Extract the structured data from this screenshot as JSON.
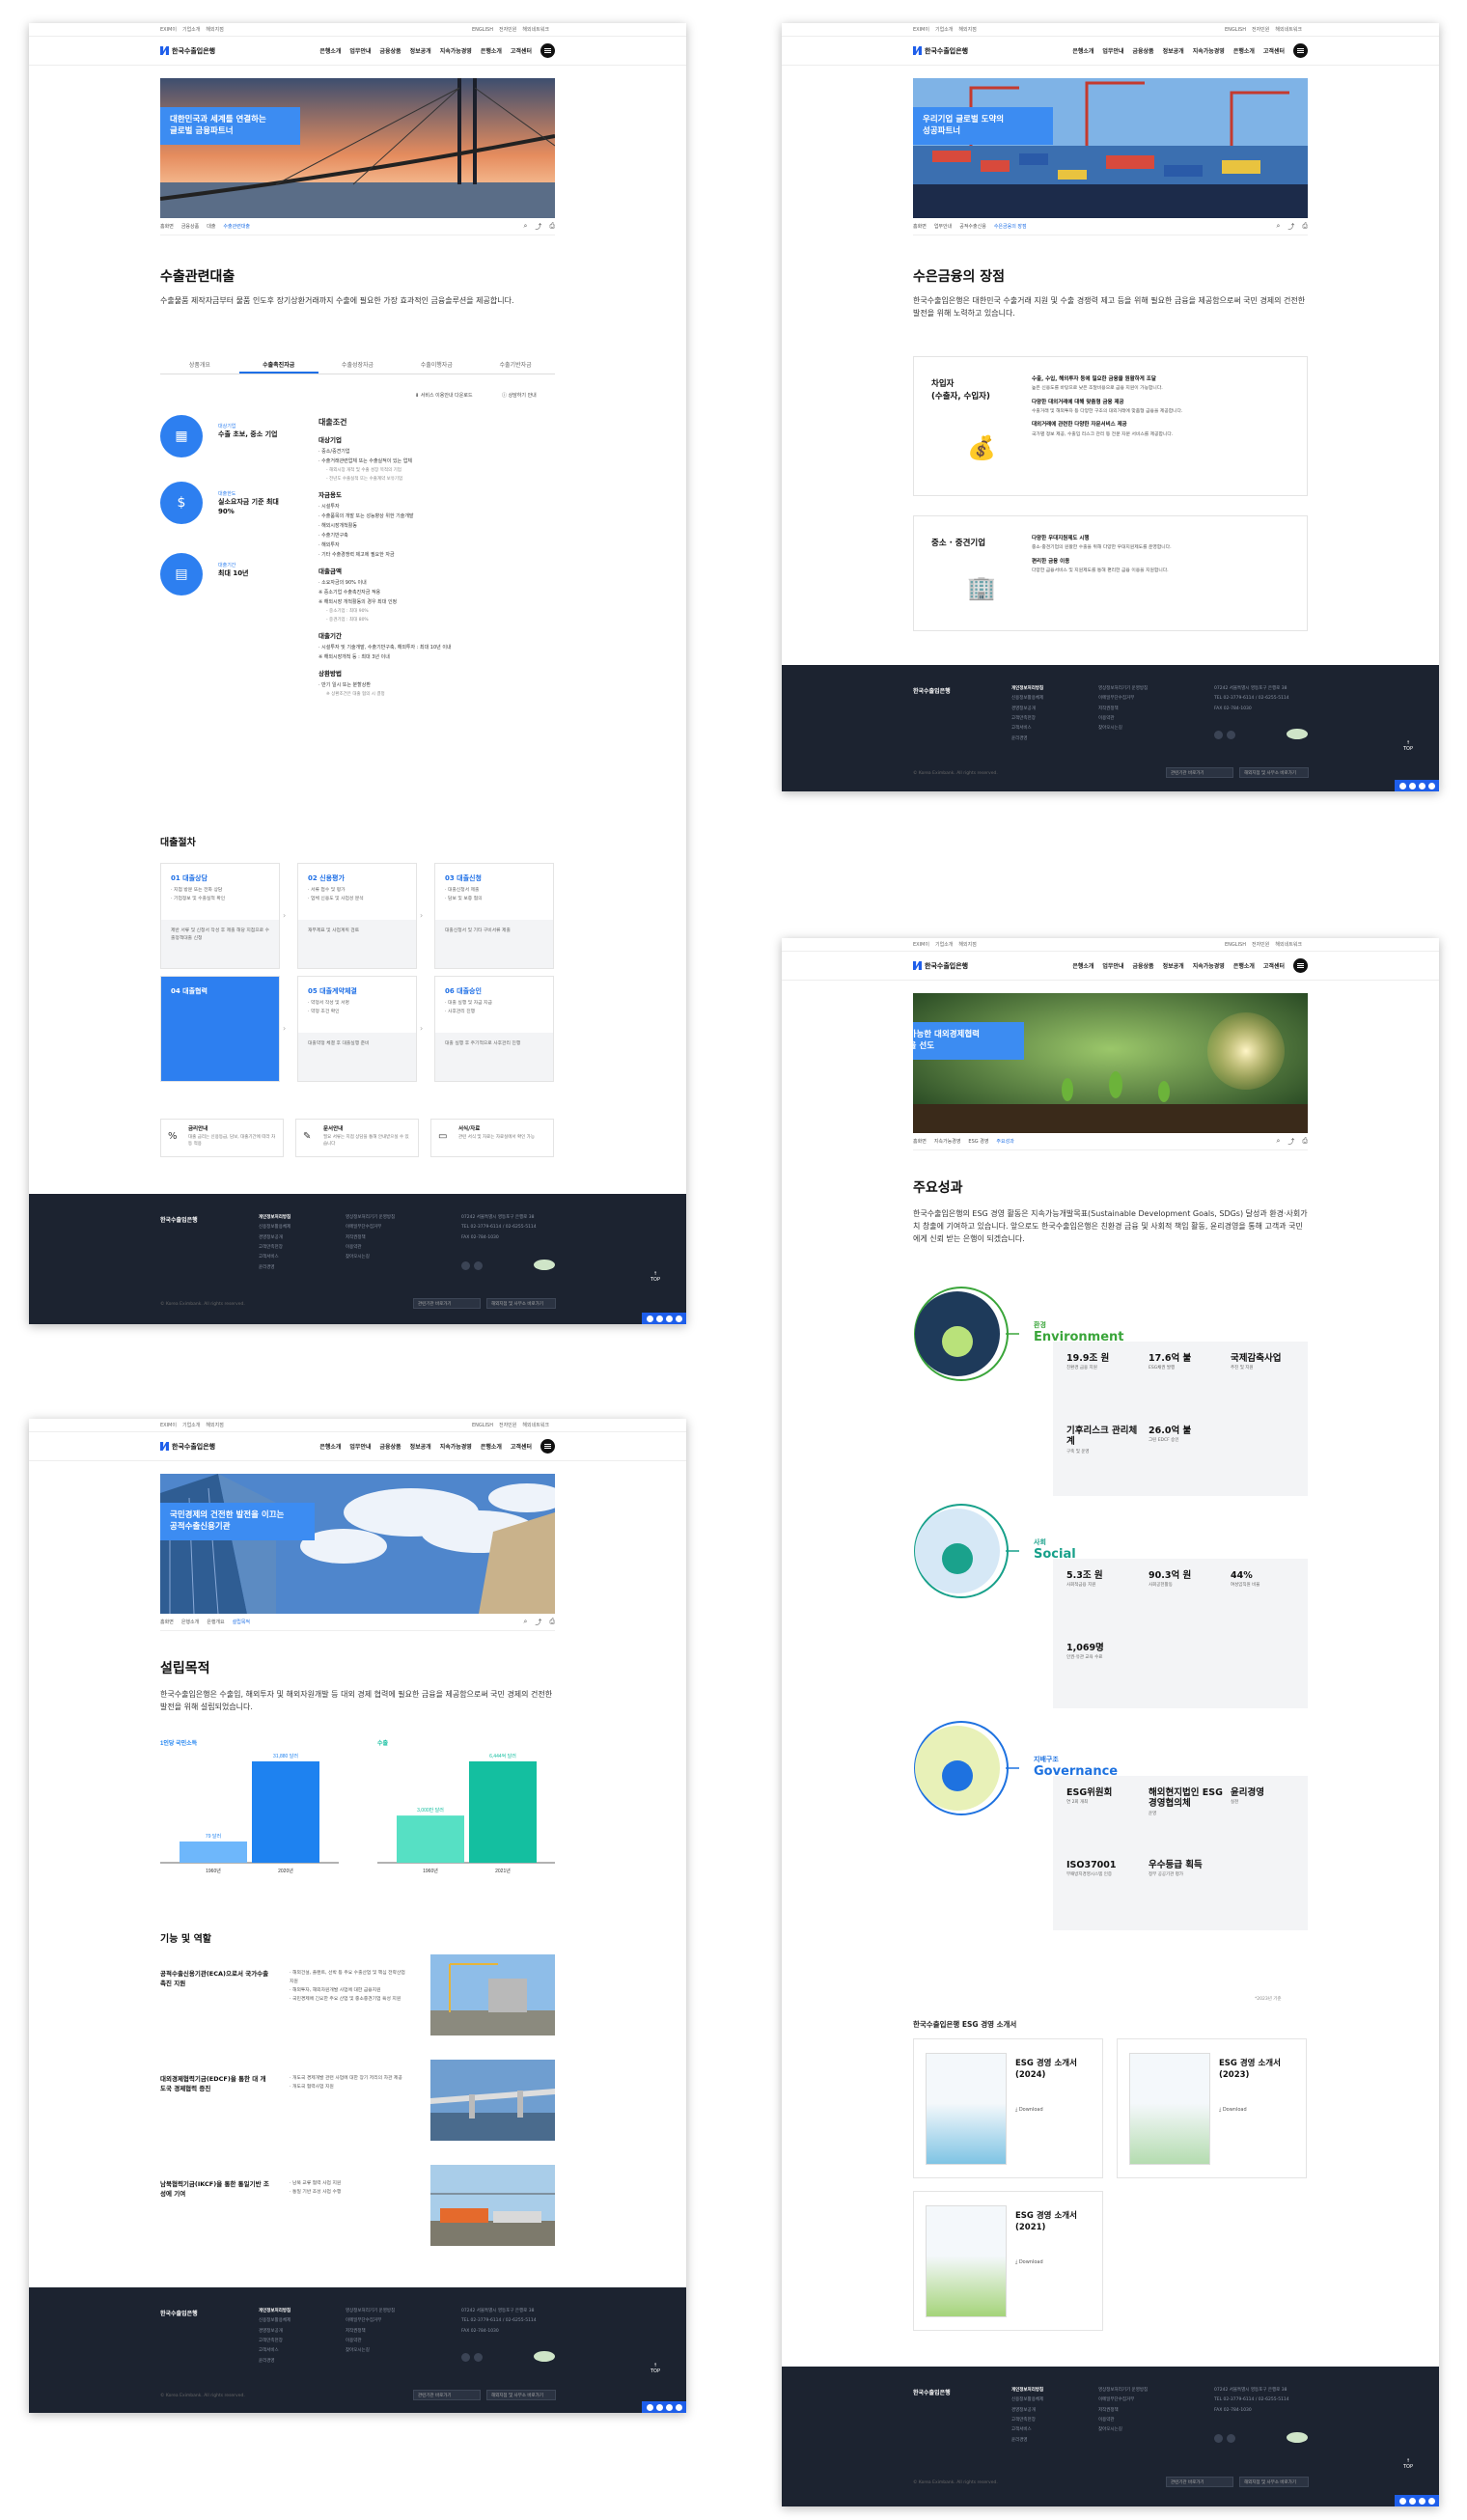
{
  "common": {
    "util": [
      "EXIM이",
      "기업소개",
      "해외지점"
    ],
    "util_right": [
      "ENGLISH",
      "전자민원",
      "해외네트워크"
    ],
    "logo": "한국수출입은행",
    "menu": [
      "은행소개",
      "업무안내",
      "금융상품",
      "정보공개",
      "지속가능경영",
      "은행소개",
      "고객센터"
    ],
    "footer": {
      "logo": "한국수출입은행",
      "col1": [
        "개인정보처리방침",
        "신용정보활용체제",
        "경영정보공개",
        "고객만족헌장",
        "고객서비스",
        "윤리경영"
      ],
      "col2": [
        "영상정보처리기기 운영방침",
        "이메일무단수집거부",
        "저작권정책",
        "이용약관",
        "찾아오시는길"
      ],
      "addr": [
        "07242 서울특별시 영등포구 은행로 38",
        "TEL 02-3779-6114 / 02-6255-5114",
        "FAX 02-784-1030"
      ],
      "copy": "© Korea Eximbank. All rights reserved.",
      "box1": "관련기관 바로가기",
      "box2": "해외지점 및 사무소 바로가기",
      "top": "TOP"
    }
  },
  "p1": {
    "hero": [
      "대한민국과 세계를 연결하는",
      "글로벌 금융파트너"
    ],
    "bread": [
      "홈화면",
      "금융상품",
      "대출",
      "수출관련대출"
    ],
    "title": "수출관련대출",
    "lead": "수출물품 제작자금부터 물품 인도후 장기상환거래까지 수출에 필요한 가장 효과적인 금융솔루션을 제공합니다.",
    "tabs": [
      "상품개요",
      "수출촉진자금",
      "수출성장자금",
      "수출이행자금",
      "수출기반자금"
    ],
    "links": [
      "서비스 이용안내 다운로드",
      "상담하기 안내"
    ],
    "items": [
      {
        "label": "대상기업",
        "value": "수출 초보, 중소 기업",
        "icon": "building-icon"
      },
      {
        "label": "대출한도",
        "value": "실소요자금 기준 최대 90%",
        "icon": "money-bag-icon"
      },
      {
        "label": "대출기간",
        "value": "최대 10년",
        "icon": "calendar-icon"
      }
    ],
    "cond_title": "대출조건",
    "cond": [
      {
        "h": "대상기업",
        "lines": [
          "· 중소/중견기업",
          "· 수출거래관련업체 또는 수출실적이 있는 업체"
        ],
        "sub": [
          "- 해외시장 개척 및 수출 성장 목적의 기업",
          "- 전년도 수출실적 또는 수출계약 보유기업"
        ]
      },
      {
        "h": "자금용도",
        "lines": [
          "· 시설투자",
          "· 수출품목의 개발 또는 성능향상 위한 기술개발",
          "· 해외시장개척활동",
          "· 수출기반구축",
          "· 해외투자",
          "· 기타 수출경쟁력 제고에 필요한 자금"
        ],
        "sub": []
      },
      {
        "h": "대출금액",
        "lines": [
          "· 소요자금의 90% 이내",
          "※ 중소기업 수출촉진자금 적용",
          "※ 해외시장 개척활동의 경우 최대 인정"
        ],
        "sub": [
          "- 중소기업 : 최대 90%",
          "- 중견기업 : 최대 80%"
        ]
      },
      {
        "h": "대출기간",
        "lines": [
          "· 시설투자 및 기술개발, 수출기반구축, 해외투자 : 최대 10년 이내",
          "※ 해외시장개척 등 : 최대 3년 이내"
        ],
        "sub": []
      },
      {
        "h": "상환방법",
        "lines": [
          "· 만기 일시 또는 분할상환"
        ],
        "sub": [
          "※ 상환조건은 대출 협의 시 결정"
        ]
      }
    ],
    "proc_title": "대출절차",
    "steps": [
      {
        "t": "01 대출상담",
        "d": [
          "· 지점 방문 또는 전화 상담",
          "· 기업정보 및 수출실적 확인"
        ],
        "g": "제반 서류 및 신청서 작성 후 제출 해당 지점으로 수출정책대출 신청"
      },
      {
        "t": "02 신용평가",
        "d": [
          "· 서류 접수 및 평가",
          "· 업체 신용도 및 사업성 분석"
        ],
        "g": "재무제표 및 사업계획 검토"
      },
      {
        "t": "03 대출신청",
        "d": [
          "· 대출신청서 제출",
          "· 담보 및 보증 협의"
        ],
        "g": "대출신청서 및 기타 구비서류 제출"
      },
      {
        "t": "04 대출협력",
        "d": [],
        "g": ""
      },
      {
        "t": "05 대출계약체결",
        "d": [
          "· 약정서 작성 및 서명",
          "· 약정 조건 확인"
        ],
        "g": "대출약정 체결 후 대출실행 준비"
      },
      {
        "t": "06 대출승인",
        "d": [
          "· 대출 실행 및 자금 지급",
          "· 사후관리 진행"
        ],
        "g": "대출 실행 후 주기적으로 사후관리 진행"
      }
    ],
    "notes": [
      {
        "t": "금리안내",
        "d": "대출 금리는 신용등급, 담보, 대출기간에 따라 차등 적용",
        "icon": "percent-icon"
      },
      {
        "t": "문서안내",
        "d": "필요 서류는 지점 상담을 통해 안내받으실 수 있습니다",
        "icon": "document-icon"
      },
      {
        "t": "서식/자료",
        "d": "관련 서식 및 자료는 자료실에서 확인 가능",
        "icon": "folder-icon"
      }
    ]
  },
  "p2": {
    "hero": [
      "우리기업 글로벌 도약의",
      "성공파트너"
    ],
    "bread": [
      "홈화면",
      "업무안내",
      "공적수출신용",
      "수은금융의 장점"
    ],
    "title": "수은금융의 장점",
    "lead": "한국수출입은행은 대한민국 수출거래 지원 및 수출 경쟁력 제고 등을 위해 필요한 금융을 제공함으로써 국민 경제의 건전한 발전을 위해 노력하고 있습니다.",
    "cards": [
      {
        "t": [
          "차입자",
          "(수출자, 수입자)"
        ],
        "icon": "money-hand-icon",
        "items": [
          {
            "h": "수출, 수입, 해외투자 등에 필요한 금융을 원활하게 조달",
            "d": "높은 신용도를 바탕으로 낮은 조달비용으로 금융 지원이 가능합니다."
          },
          {
            "h": "다양한 대외거래에 대해 맞춤형 금융 제공",
            "d": "수출거래 및 해외투자 등 다양한 구조의 대외거래에 맞춤형 금융을 제공합니다."
          },
          {
            "h": "대외거래에 관련한 다양한 자문서비스 제공",
            "d": "국가별 정보 제공, 수출입 리스크 관리 등 전문 자문 서비스를 제공합니다."
          }
        ]
      },
      {
        "t": [
          "중소 · 중견기업"
        ],
        "icon": "buildings-icon",
        "items": [
          {
            "h": "다양한 우대지원제도 시행",
            "d": "중소·중견기업의 원활한 수출을 위해 다양한 우대지원제도를 운영합니다."
          },
          {
            "h": "편리한 금융 이용",
            "d": "다양한 금융서비스 및 지원제도를 통해 편리한 금융 이용을 지원합니다."
          }
        ]
      }
    ]
  },
  "p3": {
    "hero": [
      "국민경제의 건전한 발전을 이끄는",
      "공적수출신용기관"
    ],
    "bread": [
      "홈화면",
      "은행소개",
      "은행개요",
      "설립목적"
    ],
    "title": "설립목적",
    "lead": "한국수출입은행은 수출입, 해외투자 및 해외자원개발 등 대외 경제 협력에 필요한 금융을 제공함으로써 국민 경제의 건전한 발전을 위해 설립되었습니다.",
    "charts": [
      {
        "label": "1인당 국민소득",
        "color": "#1e82f0",
        "light": "#6eb7fb",
        "cats": [
          "1960년",
          "2020년"
        ],
        "values": [
          79,
          31880
        ],
        "labels": [
          "79 달러",
          "31,880 달러"
        ]
      },
      {
        "label": "수출",
        "color": "#14bfa0",
        "light": "#56e0c4",
        "cats": [
          "1960년",
          "2021년"
        ],
        "values": [
          3000,
          6444
        ],
        "labels": [
          "3,000만 달러",
          "6,444억 달러"
        ]
      }
    ],
    "role_title": "기능 및 역할",
    "roles": [
      {
        "t": "공적수출신용기관(ECA)으로서 국가수출 촉진 지원",
        "d": [
          "· 해외건설, 플랜트, 선박 등 주요 수출산업 및 핵심 전략산업 지원",
          "· 해외투자, 해외자원개발 사업에 대한 금융지원",
          "· 국민경제에 긴요한 주요 산업 및 중소중견기업 육성 지원"
        ]
      },
      {
        "t": "대외경제협력기금(EDCF)을 통한 대 개도국 경제협력 증진",
        "d": [
          "· 개도국 경제개발 관련 사업에 대한 장기 저리의 차관 제공",
          "· 개도국 협력사업 지원"
        ]
      },
      {
        "t": "남북협력기금(IKCF)을 통한 통일기반 조성에 기여",
        "d": [
          "· 남북 교류 협력 사업 지원",
          "· 통일 기반 조성 사업 수행"
        ]
      }
    ]
  },
  "p4": {
    "hero": [
      "지속가능한 대외경제협력",
      "증진을 선도"
    ],
    "bread": [
      "홈화면",
      "지속가능경영",
      "ESG 경영",
      "주요성과"
    ],
    "title": "주요성과",
    "lead": "한국수출입은행의 ESG 경영 활동은 지속가능개발목표(Sustainable Development Goals, SDGs) 달성과 환경·사회가치 창출에 기여하고 있습니다. 앞으로도 한국수출입은행은 친환경 금융 및 사회적 책임 활동, 윤리경영을 통해 고객과 국민에게 신뢰 받는 은행이 되겠습니다.",
    "sections": [
      {
        "ko": "환경",
        "en": "Environment",
        "color": "#3aa53a",
        "kpis": [
          {
            "v": "19.9조 원",
            "d": "친환경 금융 지원"
          },
          {
            "v": "17.6억 불",
            "d": "ESG채권 발행"
          },
          {
            "v": "국제감축사업",
            "d": "추진 및 지원"
          },
          {
            "v": "기후리스크 관리체계",
            "d": "구축 및 운영"
          },
          {
            "v": "26.0억 불",
            "d": "그린 EDCF 승인"
          }
        ]
      },
      {
        "ko": "사회",
        "en": "Social",
        "color": "#17a08a",
        "kpis": [
          {
            "v": "5.3조 원",
            "d": "사회적금융 지원"
          },
          {
            "v": "90.3억 원",
            "d": "사회공헌활동"
          },
          {
            "v": "44%",
            "d": "여성임직원 비율"
          },
          {
            "v": "1,069명",
            "d": "인권·유관 교육 수료"
          }
        ]
      },
      {
        "ko": "지배구조",
        "en": "Governance",
        "color": "#1e72e0",
        "kpis": [
          {
            "v": "ESG위원회",
            "d": "연 2회 개최"
          },
          {
            "v": "해외현지법인 ESG경영협의체",
            "d": "운영"
          },
          {
            "v": "윤리경영",
            "d": "실천"
          },
          {
            "v": "ISO37001",
            "d": "부패방지경영시스템 인증"
          },
          {
            "v": "우수등급 획득",
            "d": "정부 공공기관 평가"
          }
        ]
      }
    ],
    "footnote": "*2023년 기준",
    "reports_title": "한국수출입은행 ESG 경영 소개서",
    "reports": [
      {
        "t": [
          "ESG 경영 소개서",
          "(2024)"
        ],
        "dl": "Download"
      },
      {
        "t": [
          "ESG 경영 소개서",
          "(2023)"
        ],
        "dl": "Download"
      },
      {
        "t": [
          "ESG 경영 소개서",
          "(2021)"
        ],
        "dl": "Download"
      }
    ]
  }
}
